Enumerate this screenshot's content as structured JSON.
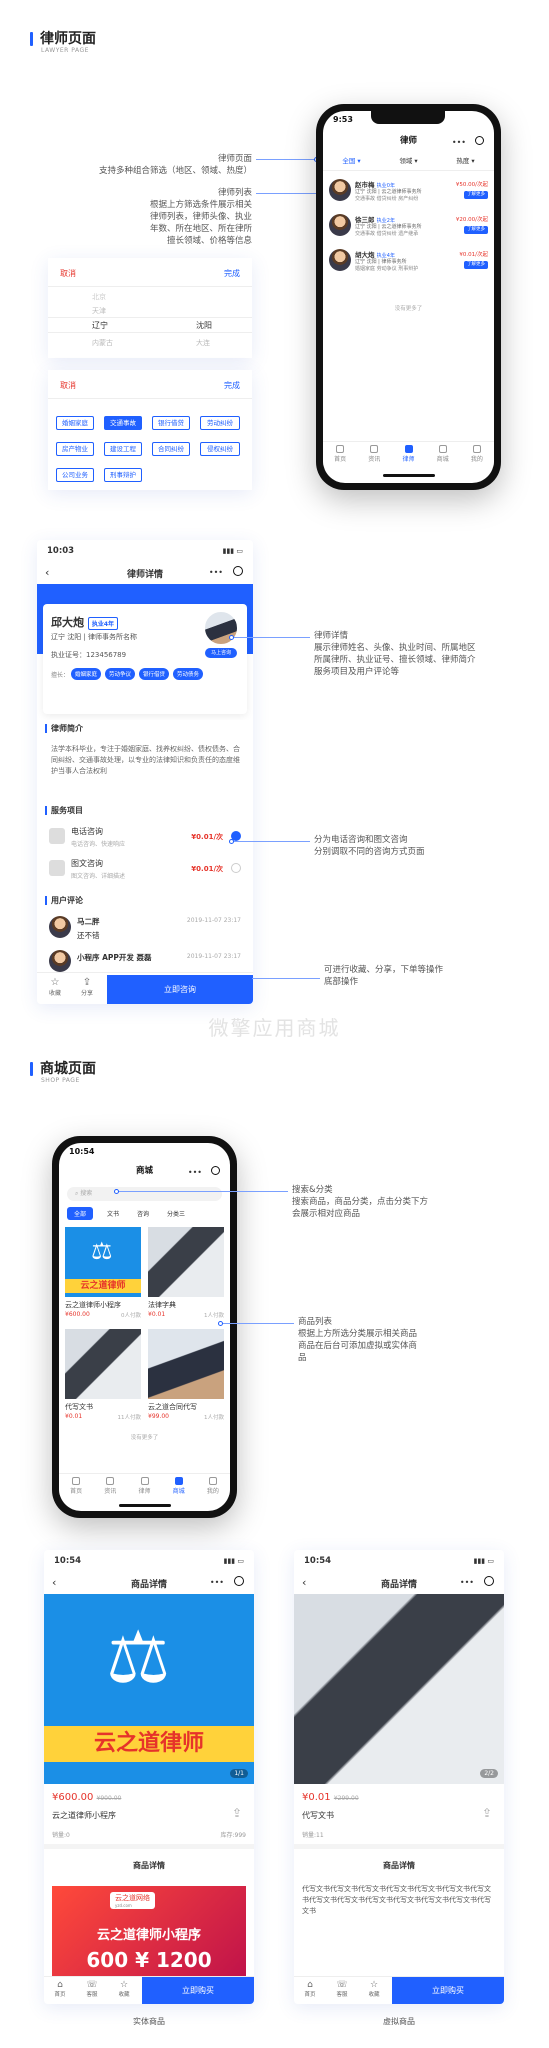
{
  "lawyer_section": {
    "title": "律师页面",
    "sub": "LAWYER PAGE"
  },
  "shop_section": {
    "title": "商城页面",
    "sub": "SHOP PAGE"
  },
  "watermark": "微擎应用商城",
  "annotations": {
    "lawyer_page": [
      "律师页面",
      "支持多种组合筛选（地区、领域、热度）"
    ],
    "lawyer_list": [
      "律师列表",
      "根据上方筛选条件展示相关",
      "律师列表，律师头像、执业",
      "年数、所在地区、所在律所",
      "擅长领域、价格等信息"
    ],
    "lawyer_detail": [
      "律师详情",
      "展示律师姓名、头像、执业时间、所属地区",
      "所属律所、执业证号、擅长领域、律师简介",
      "服务项目及用户评论等"
    ],
    "consult": [
      "分为电话咨询和图文咨询",
      "分别调取不同的咨询方式页面"
    ],
    "bottom_ops": [
      "可进行收藏、分享，下单等操作",
      "底部操作"
    ],
    "search": [
      "搜索&分类",
      "搜索商品，商品分类，点击分类下方",
      "会展示相对应商品"
    ],
    "goods_list": [
      "商品列表",
      "根据上方所选分类展示相关商品",
      "商品在后台可添加虚拟或实体商",
      "品"
    ],
    "physical": "实体商品",
    "virtual": "虚拟商品"
  },
  "phone1": {
    "time": "9:53",
    "title": "律师",
    "filters": [
      "全国",
      "领域",
      "热度"
    ],
    "lawyers": [
      {
        "name": "赵市梅",
        "years": "执业0年",
        "line1": "辽宁 沈阳 | 云之道律师事务所",
        "tags": [
          "交通事故",
          "借贷纠纷",
          "房产纠纷"
        ],
        "price": "¥50.00/次起",
        "btn": "了解更多"
      },
      {
        "name": "徐三郎",
        "years": "执业2年",
        "line1": "辽宁 沈阳 | 云之道律师事务所",
        "tags": [
          "交通事故",
          "借贷纠纷",
          "遗产继承"
        ],
        "price": "¥20.00/次起",
        "btn": "了解更多"
      },
      {
        "name": "胡大炮",
        "years": "执业4年",
        "line1": "辽宁 沈阳 | 律师事务所",
        "tags": [
          "婚姻家庭",
          "劳动争议",
          "刑事辩护"
        ],
        "price": "¥0.01/次起",
        "btn": "了解更多"
      }
    ],
    "no_more": "没有更多了",
    "tabs": [
      "首页",
      "资讯",
      "律师",
      "商城",
      "我的"
    ]
  },
  "picker": {
    "cancel": "取消",
    "done": "完成",
    "rows": [
      "北京",
      "天津",
      "辽宁",
      "内蒙古"
    ],
    "rows2": [
      "",
      "",
      "沈阳",
      "大连"
    ]
  },
  "picker2": {
    "cancel": "取消",
    "done": "完成",
    "items": [
      "婚姻家庭",
      "交通事故",
      "银行借贷",
      "劳动纠纷",
      "房产物业",
      "建设工程",
      "合同纠纷",
      "侵权纠纷",
      "公司业务",
      "刑事辩护"
    ]
  },
  "detail": {
    "time": "10:03",
    "title": "律师详情",
    "name": "邱大炮",
    "years": "执业4年",
    "loc": "辽宁 沈阳 | 律师事务所名称",
    "license": "执业证号：123456789",
    "tags": [
      "婚姻家庭",
      "劳动争议",
      "银行借贷",
      "劳动债务"
    ],
    "consult_btn": "马上咨询",
    "intro_title": "律师简介",
    "intro": "法学本科毕业，专注于婚姻家庭、找养权纠纷、债权债务、合同纠纷、交通事故处理，以专业的法律知识和负责任的态度维护当事人合法权利",
    "svc_title": "服务项目",
    "services": [
      {
        "name": "电话咨询",
        "desc": "电话咨询、快速响应",
        "price": "¥0.01/次"
      },
      {
        "name": "图文咨询",
        "desc": "图文咨询、详细描述",
        "price": "¥0.01/次"
      }
    ],
    "cmt_title": "用户评论",
    "comments": [
      {
        "user": "马二胖",
        "text": "还不错",
        "time": "2019-11-07 23:17"
      },
      {
        "user": "小程序 APP开发 聂磊",
        "text": "",
        "time": "2019-11-07 23:17"
      }
    ],
    "fav": "收藏",
    "share": "分享",
    "buy": "立即咨询"
  },
  "shop": {
    "time": "10:54",
    "title": "商城",
    "search": "搜索",
    "cats": [
      "全部",
      "文书",
      "咨询",
      "分类三"
    ],
    "goods": [
      {
        "title": "云之道律师小程序",
        "price": "¥600.00",
        "sold": "0人付款"
      },
      {
        "title": "法律字典",
        "price": "¥0.01",
        "sold": "1人付款"
      },
      {
        "title": "代写文书",
        "price": "¥0.01",
        "sold": "11人付款"
      },
      {
        "title": "云之道合同代写",
        "price": "¥99.00",
        "sold": "1人付款"
      }
    ],
    "no_more": "没有更多了",
    "banner_text": "云之道律师",
    "tabs": [
      "首页",
      "资讯",
      "律师",
      "商城",
      "我的"
    ]
  },
  "gd1": {
    "time": "10:54",
    "title": "商品详情",
    "banner_text": "云之道律师",
    "counter": "1/1",
    "price": "¥600.00",
    "orig": "¥900.00",
    "name": "云之道律师小程序",
    "sales": "销量:0",
    "stock": "库存:999",
    "detail_title": "商品详情",
    "promo_brand": "云之道网络",
    "promo_url": "yzd.com",
    "promo_text": "云之道律师小程序",
    "promo_nums": "600 ¥ 1200",
    "tab_home": "首页",
    "tab_cs": "客服",
    "tab_fav": "收藏",
    "buy": "立即购买"
  },
  "gd2": {
    "time": "10:54",
    "title": "商品详情",
    "counter": "2/2",
    "price": "¥0.01",
    "orig": "¥299.00",
    "name": "代写文书",
    "sales": "销量:11",
    "detail_title": "商品详情",
    "detail": "代写文书代写文书代写文书代写文书代写文书代写文书代写文书代写文书代写文书代写文书代写文书代写文书代写文书代写文书",
    "tab_home": "首页",
    "tab_cs": "客服",
    "tab_fav": "收藏",
    "buy": "立即购买"
  }
}
